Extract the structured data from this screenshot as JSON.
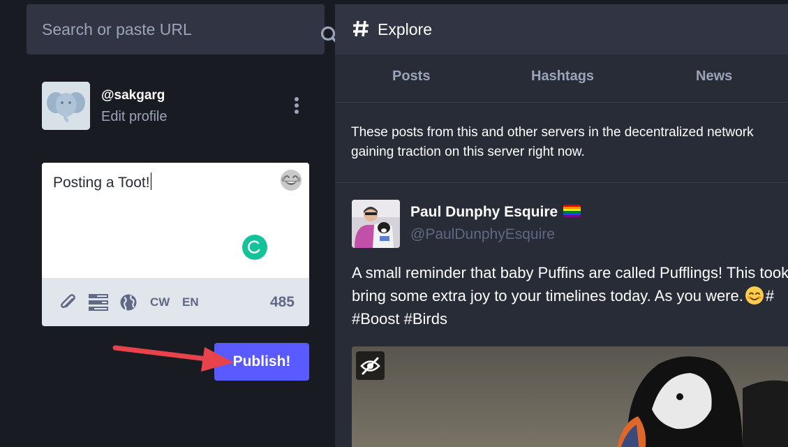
{
  "search": {
    "placeholder": "Search or paste URL",
    "icon": "search-icon"
  },
  "profile": {
    "handle": "@sakgarg",
    "edit_label": "Edit profile",
    "menu_icon": "vertical-ellipsis-icon"
  },
  "compose": {
    "text": "Posting a Toot!",
    "emoji_icon": "laughing-emoji-icon",
    "toolbar": {
      "attach_icon": "paperclip-icon",
      "poll_icon": "poll-icon",
      "visibility_icon": "globe-icon",
      "cw_label": "CW",
      "language_label": "EN",
      "char_count": "485"
    },
    "publish_label": "Publish!"
  },
  "column": {
    "title": "Explore",
    "icon": "hashtag-icon",
    "tabs": [
      {
        "label": "Posts"
      },
      {
        "label": "Hashtags"
      },
      {
        "label": "News"
      }
    ],
    "intro_line1": "These posts from this and other servers in the decentralized network",
    "intro_line2": "gaining traction on this server right now."
  },
  "status": {
    "display_name": "Paul Dunphy Esquire",
    "handle": "@PaulDunphyEsquire",
    "line1": "A small reminder that baby Puffins are called Pufflings! This took",
    "line2_before": "bring some extra joy to your timelines today. As you were.",
    "line2_after": "#",
    "line3": "#Boost #Birds",
    "media_hide_icon": "eye-slash-icon"
  },
  "colors": {
    "background": "#191b22",
    "panel": "#282c37",
    "header": "#313543",
    "accent": "#595aff",
    "annotation": "#e8434a"
  }
}
